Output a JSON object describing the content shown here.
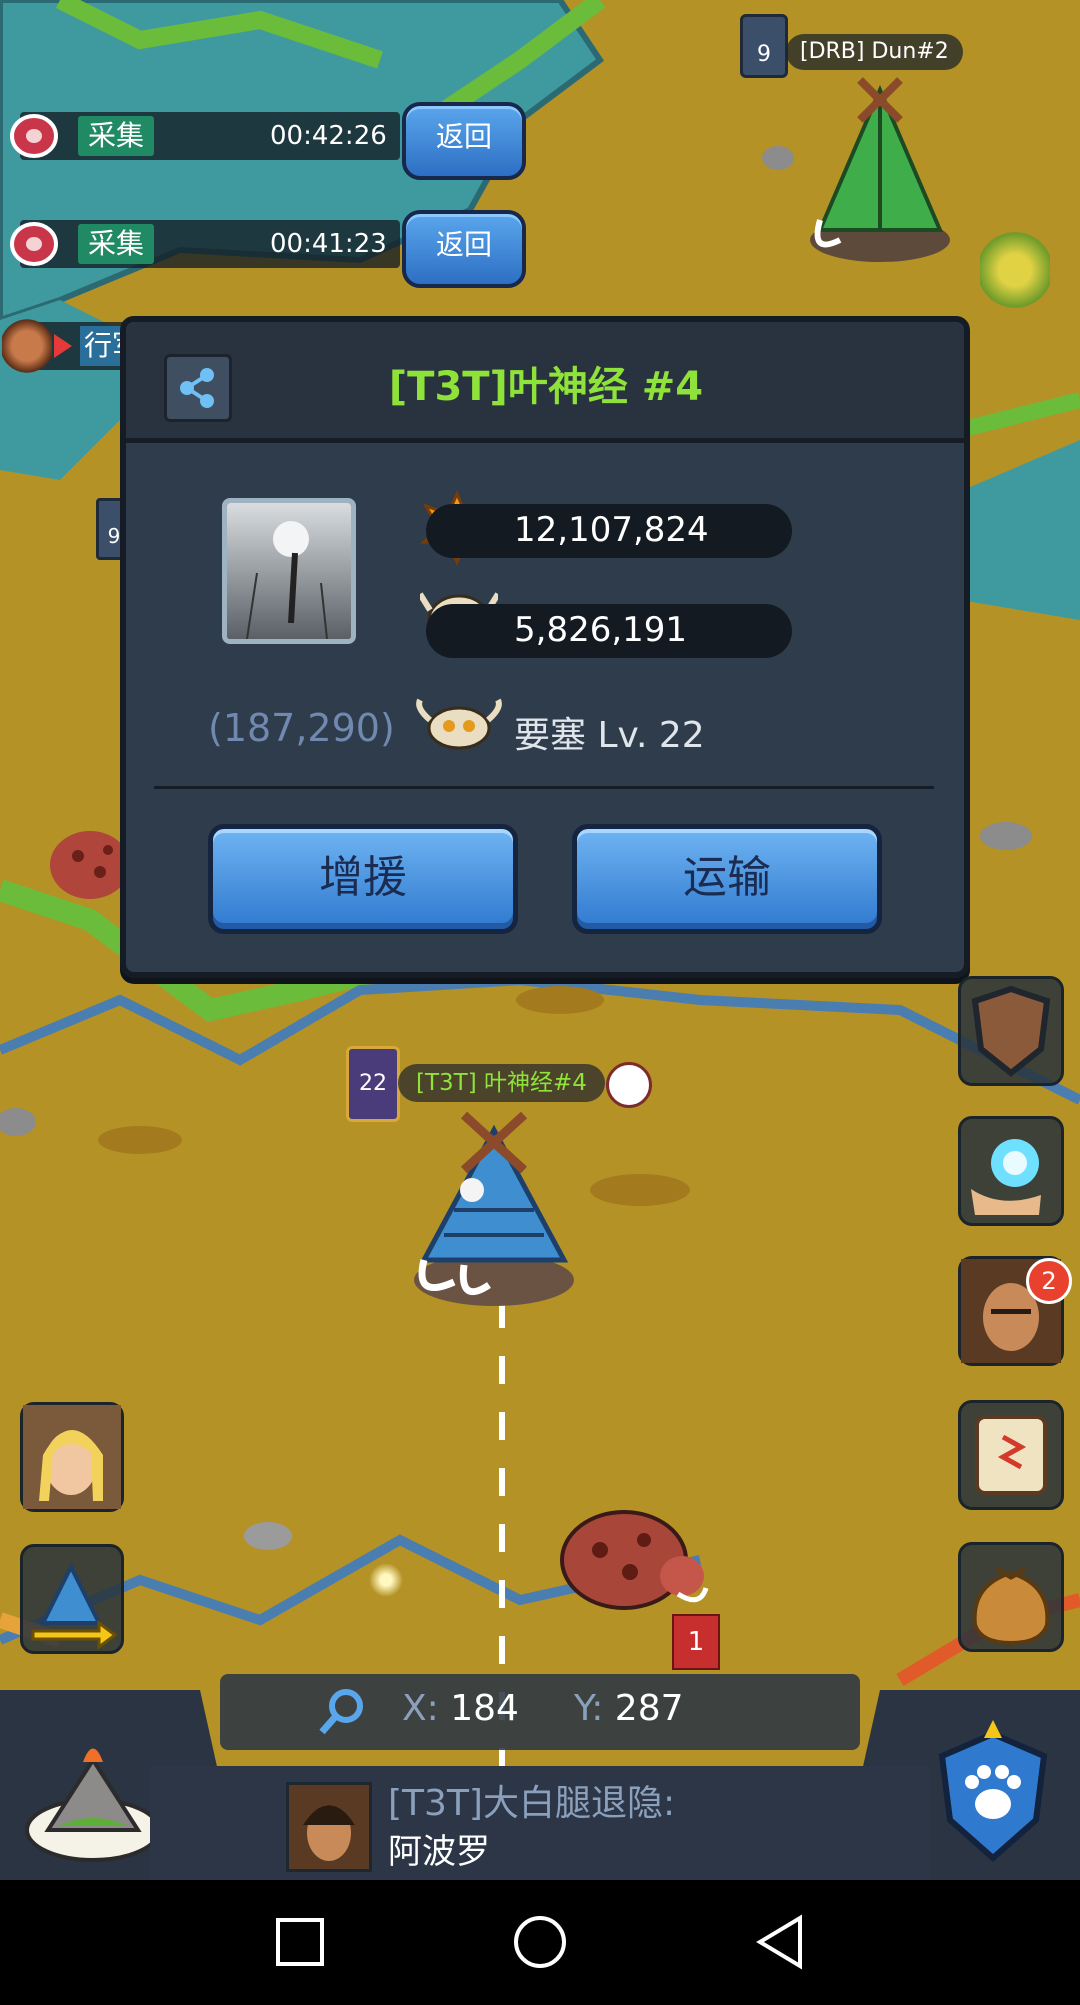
{
  "marches": [
    {
      "tag": "采集",
      "time": "00:42:26",
      "button": "返回"
    },
    {
      "tag": "采集",
      "time": "00:41:23",
      "button": "返回"
    }
  ],
  "partial_march_label": "行军",
  "map_labels": {
    "top_player_level": "9",
    "top_player_name": "[DRB] Dun#2",
    "left_player_level": "9",
    "own_city_level": "22",
    "own_city_name": "[T3T] 叶神经#4",
    "flag_number": "1"
  },
  "popup": {
    "title": "[T3T]叶神经 #4",
    "power": "12,107,824",
    "kills": "5,826,191",
    "coords": "(187,290)",
    "fort_level": "要塞 Lv. 22",
    "reinforce_label": "增援",
    "transport_label": "运输"
  },
  "side_icons": {
    "hero_badge": "2"
  },
  "bottom": {
    "x_label": "X:",
    "x_value": "184",
    "y_label": "Y:",
    "y_value": "287",
    "chat_name": "[T3T]大白腿退隐:",
    "chat_message": "阿波罗"
  },
  "colors": {
    "title_green": "#8fe23a",
    "button_blue": "#2f79cf",
    "panel": "#2f3c4b",
    "terrain": "#b49226",
    "water": "#3f9aa0"
  }
}
